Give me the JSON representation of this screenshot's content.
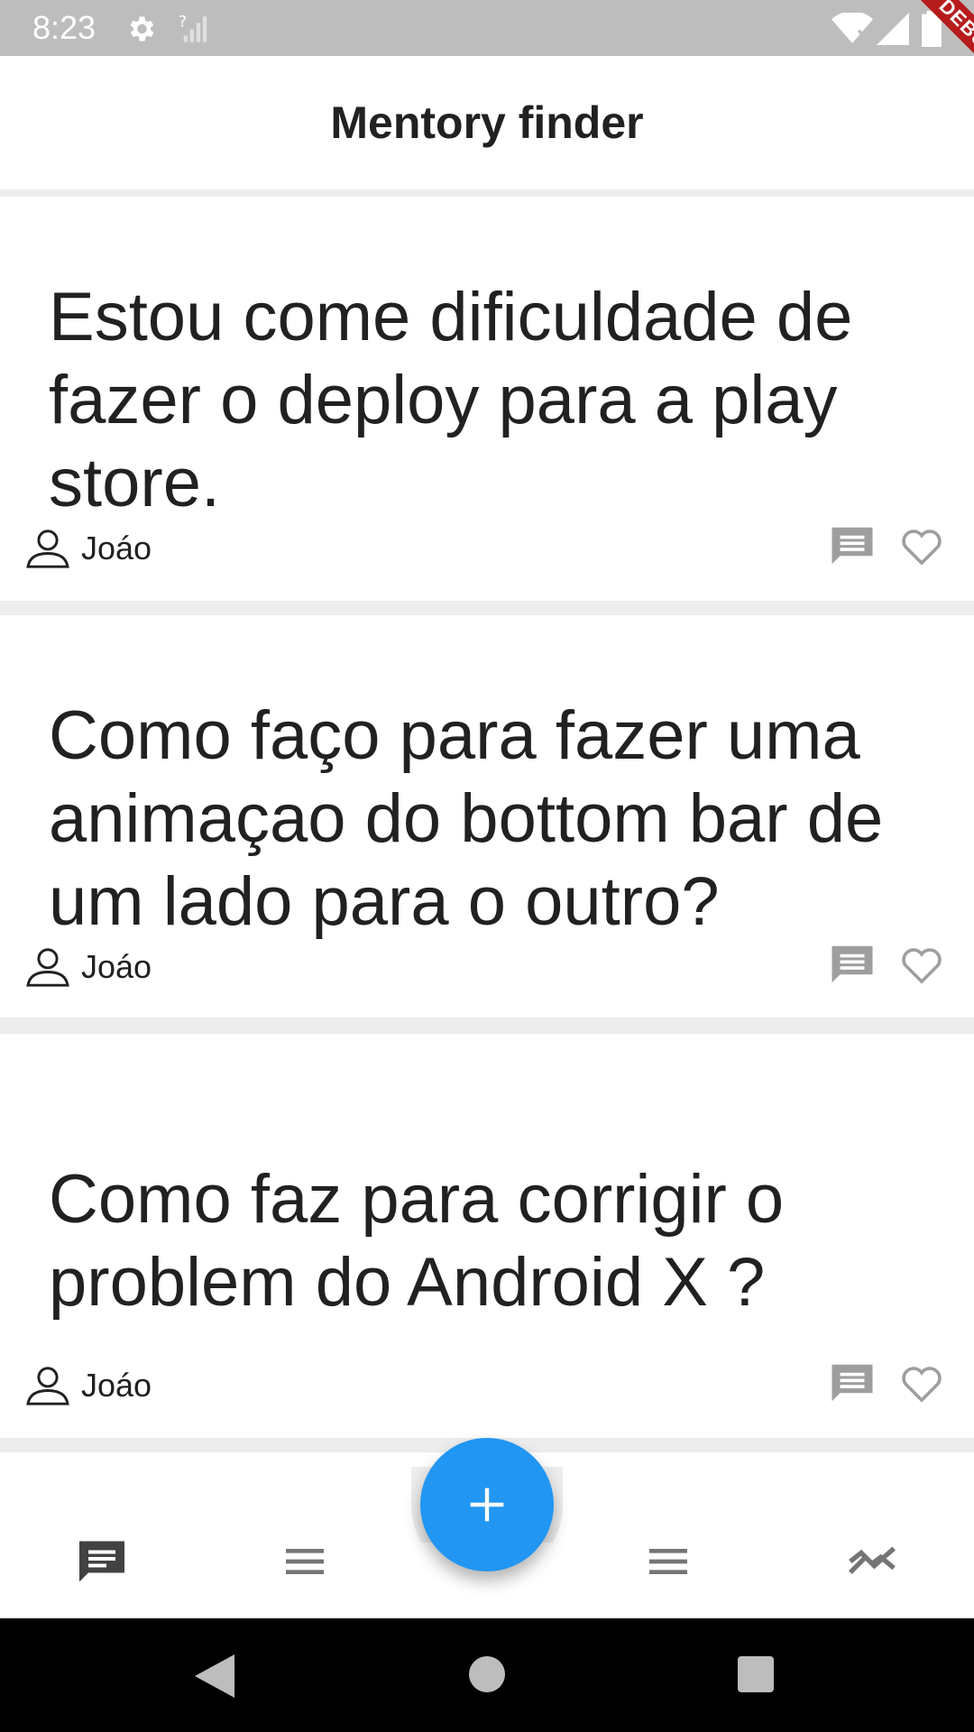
{
  "status_bar": {
    "time": "8:23"
  },
  "debug_banner": {
    "label": "DEBUG"
  },
  "app_bar": {
    "title": "Mentory finder"
  },
  "posts": [
    {
      "text": "Estou come dificuldade de fazer o deploy para a play store.",
      "author": "Joáo"
    },
    {
      "text": "Como faço para fazer uma animaçao do bottom bar de um lado para o outro?",
      "author": "Joáo"
    },
    {
      "text": "Como faz para corrigir o problem do Android X ?",
      "author": "Joáo"
    }
  ],
  "bottom_nav": {
    "items": [
      "chat-icon",
      "menu-icon",
      "menu-icon",
      "trending-icon"
    ],
    "fab_icon": "add-icon"
  },
  "colors": {
    "accent": "#2196f3",
    "icon_grey": "#9e9e9e",
    "status_bar": "#bdbdbd"
  }
}
